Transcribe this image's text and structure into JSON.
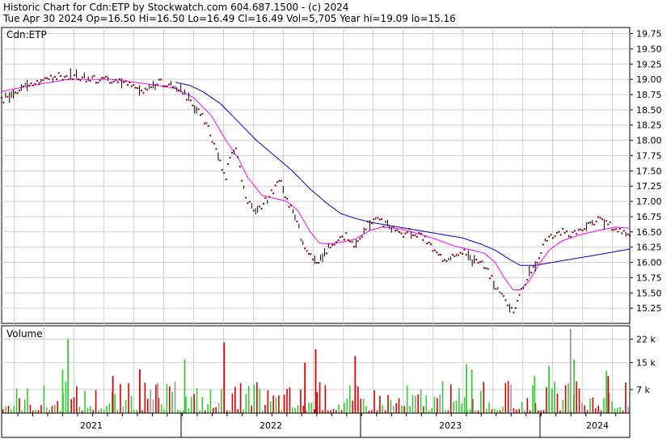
{
  "header": {
    "line1": "Historic Chart for Cdn:ETP  by Stockwatch.com 604.687.1500 - (c) 2024",
    "line2": "Tue Apr 30 2024   Op=16.50   Hi=16.50  Lo=16.49  Cl=16.49   Vol=5,705   Year hi=19.09   lo=15.16"
  },
  "colors": {
    "price": "#880000",
    "ma_short": "#ff00ff",
    "ma_long": "#0000cc",
    "vol_up": "#33cc33",
    "vol_down": "#dd0000",
    "vol_flat": "#999999",
    "grid": "#cfcfcf",
    "frame": "#000000"
  },
  "chart_data": [
    {
      "type": "line",
      "title": "Cdn:ETP",
      "ylim": [
        15.0,
        19.85
      ],
      "yticks": [
        19.75,
        19.5,
        19.25,
        19.0,
        18.75,
        18.5,
        18.25,
        18.0,
        17.75,
        17.5,
        17.25,
        17.0,
        16.75,
        16.5,
        16.25,
        16.0,
        15.75,
        15.5,
        15.25
      ],
      "ytick_labels": [
        "19.75",
        "19.50",
        "19.25",
        "19.00",
        "18.75",
        "18.50",
        "18.25",
        "18.00",
        "17.75",
        "17.50",
        "17.25",
        "17.00",
        "16.75",
        "16.50",
        "16.25",
        "16.00",
        "15.75",
        "15.50",
        "15.25"
      ],
      "xlim": [
        2020.83,
        2024.33
      ],
      "x_labels": [
        {
          "text": "2021",
          "x": 2021.33
        },
        {
          "text": "2022",
          "x": 2022.33
        },
        {
          "text": "2023",
          "x": 2023.33
        },
        {
          "text": "2024",
          "x": 2024.15
        }
      ],
      "x_year_boundaries": [
        2021.83,
        2022.83,
        2023.83
      ],
      "price_knots": [
        [
          2020.83,
          18.65
        ],
        [
          2020.88,
          18.75
        ],
        [
          2020.95,
          18.9
        ],
        [
          2021.05,
          18.95
        ],
        [
          2021.15,
          19.05
        ],
        [
          2021.25,
          19.05
        ],
        [
          2021.35,
          19.0
        ],
        [
          2021.45,
          19.0
        ],
        [
          2021.55,
          18.9
        ],
        [
          2021.62,
          18.8
        ],
        [
          2021.7,
          18.95
        ],
        [
          2021.78,
          18.9
        ],
        [
          2021.85,
          18.75
        ],
        [
          2021.9,
          18.55
        ],
        [
          2021.95,
          18.4
        ],
        [
          2021.98,
          18.2
        ],
        [
          2022.02,
          17.9
        ],
        [
          2022.05,
          17.6
        ],
        [
          2022.08,
          17.4
        ],
        [
          2022.1,
          17.7
        ],
        [
          2022.13,
          17.9
        ],
        [
          2022.16,
          17.5
        ],
        [
          2022.2,
          17.0
        ],
        [
          2022.25,
          16.85
        ],
        [
          2022.3,
          17.0
        ],
        [
          2022.35,
          17.2
        ],
        [
          2022.38,
          17.35
        ],
        [
          2022.42,
          17.0
        ],
        [
          2022.46,
          16.85
        ],
        [
          2022.5,
          16.4
        ],
        [
          2022.55,
          16.1
        ],
        [
          2022.6,
          16.0
        ],
        [
          2022.65,
          16.25
        ],
        [
          2022.7,
          16.35
        ],
        [
          2022.75,
          16.45
        ],
        [
          2022.8,
          16.25
        ],
        [
          2022.85,
          16.55
        ],
        [
          2022.9,
          16.7
        ],
        [
          2022.95,
          16.65
        ],
        [
          2023.0,
          16.55
        ],
        [
          2023.05,
          16.45
        ],
        [
          2023.1,
          16.5
        ],
        [
          2023.15,
          16.45
        ],
        [
          2023.2,
          16.35
        ],
        [
          2023.25,
          16.15
        ],
        [
          2023.3,
          16.05
        ],
        [
          2023.35,
          16.15
        ],
        [
          2023.4,
          16.2
        ],
        [
          2023.45,
          16.05
        ],
        [
          2023.5,
          16.0
        ],
        [
          2023.55,
          15.8
        ],
        [
          2023.6,
          15.5
        ],
        [
          2023.65,
          15.35
        ],
        [
          2023.68,
          15.2
        ],
        [
          2023.72,
          15.5
        ],
        [
          2023.76,
          15.75
        ],
        [
          2023.8,
          15.95
        ],
        [
          2023.85,
          16.3
        ],
        [
          2023.9,
          16.45
        ],
        [
          2023.95,
          16.5
        ],
        [
          2024.0,
          16.45
        ],
        [
          2024.05,
          16.55
        ],
        [
          2024.1,
          16.6
        ],
        [
          2024.15,
          16.7
        ],
        [
          2024.2,
          16.65
        ],
        [
          2024.25,
          16.55
        ],
        [
          2024.3,
          16.5
        ],
        [
          2024.33,
          16.49
        ]
      ],
      "ma_short_knots": [
        [
          2020.83,
          18.8
        ],
        [
          2021.0,
          18.9
        ],
        [
          2021.2,
          19.0
        ],
        [
          2021.45,
          19.0
        ],
        [
          2021.7,
          18.9
        ],
        [
          2021.8,
          18.85
        ],
        [
          2021.9,
          18.7
        ],
        [
          2022.0,
          18.4
        ],
        [
          2022.08,
          18.0
        ],
        [
          2022.15,
          17.7
        ],
        [
          2022.2,
          17.4
        ],
        [
          2022.28,
          17.1
        ],
        [
          2022.35,
          17.05
        ],
        [
          2022.42,
          17.0
        ],
        [
          2022.48,
          16.85
        ],
        [
          2022.55,
          16.5
        ],
        [
          2022.6,
          16.32
        ],
        [
          2022.65,
          16.3
        ],
        [
          2022.72,
          16.33
        ],
        [
          2022.8,
          16.38
        ],
        [
          2022.88,
          16.52
        ],
        [
          2022.95,
          16.58
        ],
        [
          2023.05,
          16.55
        ],
        [
          2023.15,
          16.47
        ],
        [
          2023.25,
          16.38
        ],
        [
          2023.35,
          16.27
        ],
        [
          2023.45,
          16.2
        ],
        [
          2023.52,
          16.15
        ],
        [
          2023.58,
          16.0
        ],
        [
          2023.63,
          15.75
        ],
        [
          2023.68,
          15.55
        ],
        [
          2023.72,
          15.55
        ],
        [
          2023.77,
          15.7
        ],
        [
          2023.82,
          15.95
        ],
        [
          2023.88,
          16.2
        ],
        [
          2023.95,
          16.35
        ],
        [
          2024.05,
          16.45
        ],
        [
          2024.15,
          16.52
        ],
        [
          2024.25,
          16.58
        ],
        [
          2024.33,
          16.56
        ]
      ],
      "ma_long_knots": [
        [
          2021.8,
          18.95
        ],
        [
          2021.88,
          18.9
        ],
        [
          2021.95,
          18.8
        ],
        [
          2022.05,
          18.6
        ],
        [
          2022.15,
          18.3
        ],
        [
          2022.25,
          18.0
        ],
        [
          2022.35,
          17.75
        ],
        [
          2022.45,
          17.5
        ],
        [
          2022.55,
          17.2
        ],
        [
          2022.65,
          16.95
        ],
        [
          2022.72,
          16.8
        ],
        [
          2022.8,
          16.72
        ],
        [
          2022.9,
          16.65
        ],
        [
          2023.0,
          16.6
        ],
        [
          2023.1,
          16.55
        ],
        [
          2023.2,
          16.5
        ],
        [
          2023.3,
          16.45
        ],
        [
          2023.4,
          16.4
        ],
        [
          2023.5,
          16.3
        ],
        [
          2023.58,
          16.2
        ],
        [
          2023.66,
          16.05
        ],
        [
          2023.72,
          15.95
        ],
        [
          2023.8,
          15.95
        ],
        [
          2023.9,
          16.0
        ],
        [
          2024.0,
          16.05
        ],
        [
          2024.1,
          16.1
        ],
        [
          2024.2,
          16.15
        ],
        [
          2024.33,
          16.22
        ]
      ]
    },
    {
      "type": "bar",
      "title": "Volume",
      "ylim": [
        0,
        25000
      ],
      "yticks": [
        22000,
        15000,
        7000
      ],
      "ytick_labels": [
        "22 k",
        "15 k",
        "7 k"
      ],
      "count": 230,
      "spikes": [
        {
          "x": 2021.2,
          "value": 22000,
          "dir": "up"
        },
        {
          "x": 2021.17,
          "value": 13000,
          "dir": "up"
        },
        {
          "x": 2021.45,
          "value": 11000,
          "dir": "down"
        },
        {
          "x": 2021.6,
          "value": 13000,
          "dir": "down"
        },
        {
          "x": 2021.7,
          "value": 9000,
          "dir": "flat"
        },
        {
          "x": 2021.85,
          "value": 16000,
          "dir": "up"
        },
        {
          "x": 2022.07,
          "value": 21000,
          "dir": "down"
        },
        {
          "x": 2022.58,
          "value": 19000,
          "dir": "down"
        },
        {
          "x": 2022.52,
          "value": 15000,
          "dir": "down"
        },
        {
          "x": 2022.8,
          "value": 17000,
          "dir": "down"
        },
        {
          "x": 2023.42,
          "value": 14500,
          "dir": "up"
        },
        {
          "x": 2023.45,
          "value": 13000,
          "dir": "up"
        },
        {
          "x": 2023.8,
          "value": 11000,
          "dir": "up"
        },
        {
          "x": 2023.88,
          "value": 14000,
          "dir": "up"
        },
        {
          "x": 2024.0,
          "value": 25000,
          "dir": "flat"
        },
        {
          "x": 2024.02,
          "value": 16000,
          "dir": "up"
        },
        {
          "x": 2024.2,
          "value": 12500,
          "dir": "up"
        },
        {
          "x": 2024.21,
          "value": 11000,
          "dir": "down"
        }
      ]
    }
  ]
}
